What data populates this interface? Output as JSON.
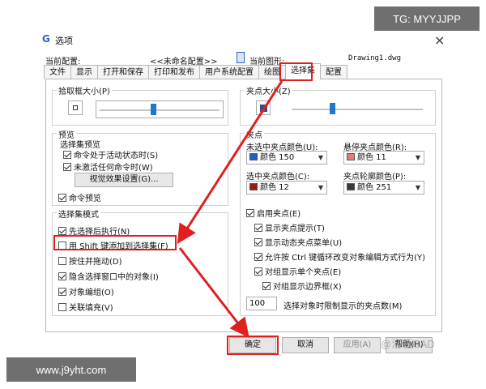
{
  "watermarks": {
    "top": "TG: MYYJJPP",
    "bottom": "www.j9yht.com",
    "brand": "@洛画CAD"
  },
  "window": {
    "title": "选项",
    "close": "×"
  },
  "header": {
    "profile_label": "当前配置:",
    "profile_value": "<<未命名配置>>",
    "drawing_label": "当前图形:",
    "drawing_value": "Drawing1.dwg"
  },
  "tabs": [
    {
      "label": "文件"
    },
    {
      "label": "显示"
    },
    {
      "label": "打开和保存"
    },
    {
      "label": "打印和发布"
    },
    {
      "label": "用户系统配置"
    },
    {
      "label": "绘图"
    },
    {
      "label": "选择集"
    },
    {
      "label": "配置"
    }
  ],
  "left": {
    "pickbox_title": "拾取框大小(P)",
    "pickbox_level": 0.45,
    "preview_title": "预览",
    "preview_sub": "选择集预览",
    "preview_items": [
      {
        "label": "命令处于活动状态时(S)",
        "checked": true
      },
      {
        "label": "未激活任何命令时(W)",
        "checked": true
      }
    ],
    "visual_effects_button": "视觉效果设置(G)...",
    "command_preview": {
      "label": "命令预览",
      "checked": true
    },
    "mode_title": "选择集模式",
    "mode_items": [
      {
        "label": "先选择后执行(N)",
        "checked": true
      },
      {
        "label": "用 Shift 键添加到选择集(F)",
        "checked": false
      },
      {
        "label": "按住并拖动(D)",
        "checked": false
      },
      {
        "label": "隐含选择窗口中的对象(I)",
        "checked": true
      },
      {
        "label": "对象编组(O)",
        "checked": true
      },
      {
        "label": "关联填充(V)",
        "checked": false
      }
    ]
  },
  "right": {
    "grip_size_title": "夹点大小(Z)",
    "grip_size_level": 0.3,
    "grips_title": "夹点",
    "unselected_label": "未选中夹点颜色(U):",
    "unselected_value": "颜色 150",
    "hover_label": "悬停夹点颜色(R):",
    "hover_value": "颜色 11",
    "selected_label": "选中夹点颜色(C):",
    "selected_value": "颜色 12",
    "contour_label": "夹点轮廓颜色(P):",
    "contour_value": "颜色 251",
    "colors": {
      "unselected": "#1f5fbf",
      "hover": "#e87a7a",
      "selected": "#a01818",
      "contour": "#3a3a3a",
      "grip_preview": "#2d4a8f"
    },
    "grip_items": [
      {
        "label": "启用夹点(E)",
        "checked": true
      },
      {
        "label": "显示夹点提示(T)",
        "checked": true
      },
      {
        "label": "显示动态夹点菜单(U)",
        "checked": true
      },
      {
        "label": "允许按 Ctrl 键循环改变对象编辑方式行为(Y)",
        "checked": true
      },
      {
        "label": "对组显示单个夹点(E)",
        "checked": true
      },
      {
        "label": "对组显示边界框(X)",
        "checked": true
      }
    ],
    "grip_limit_value": "100",
    "grip_limit_label": "选择对象时限制显示的夹点数(M)"
  },
  "footer": {
    "ok": "确定",
    "cancel": "取消",
    "apply": "应用(A)",
    "help": "帮助(H)"
  },
  "accent": "#e02020"
}
